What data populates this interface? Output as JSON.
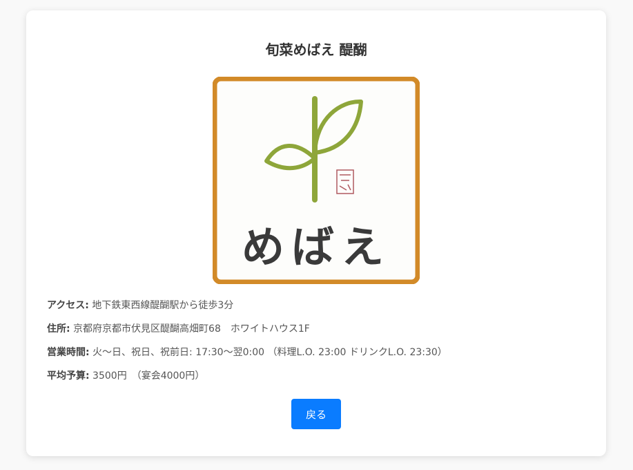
{
  "restaurant": {
    "name": "旬菜めばえ 醍醐",
    "logo_text": "めばえ"
  },
  "details": [
    {
      "label": "アクセス:",
      "value": " 地下鉄東西線醍醐駅から徒歩3分"
    },
    {
      "label": "住所:",
      "value": " 京都府京都市伏見区醍醐高畑町68　ホワイトハウス1F"
    },
    {
      "label": "営業時間:",
      "value": " 火～日、祝日、祝前日: 17:30～翌0:00 （料理L.O. 23:00 ドリンクL.O. 23:30）"
    },
    {
      "label": "平均予算:",
      "value": " 3500円　（宴会4000円）"
    }
  ],
  "back_button": {
    "label": "戻る"
  },
  "colors": {
    "accent": "#0a7cff",
    "logo_border": "#d28a28",
    "sprout": "#8ea63a",
    "stamp": "#b05a60"
  }
}
